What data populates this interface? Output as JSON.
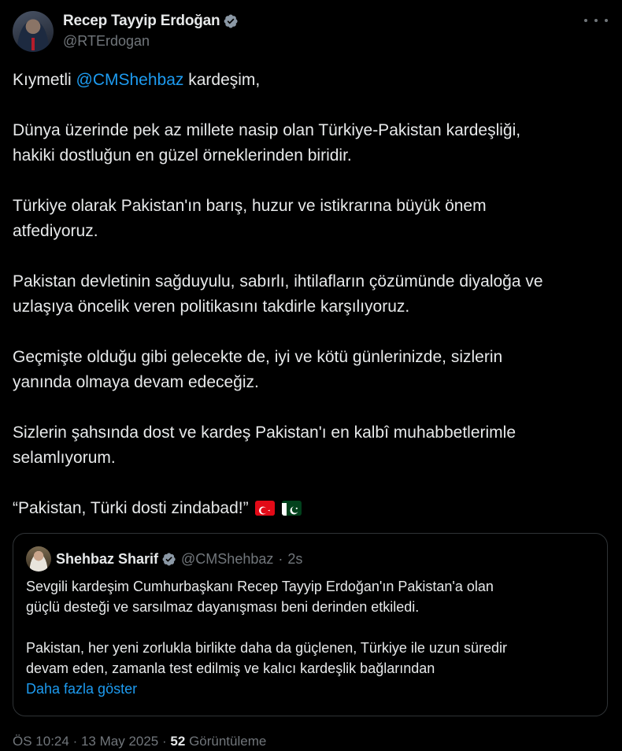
{
  "author": {
    "display_name": "Recep Tayyip Erdoğan",
    "handle": "@RTErdogan",
    "verified": true
  },
  "tweet": {
    "greeting_prefix": "Kıymetli ",
    "greeting_mention": "@CMShehbaz",
    "greeting_suffix": " kardeşim,",
    "paragraphs": [
      [
        "Dünya üzerinde pek az millete nasip olan Türkiye-Pakistan kardeşliği,",
        "hakiki dostluğun en güzel örneklerinden biridir."
      ],
      [
        "Türkiye olarak Pakistan'ın barış, huzur ve istikrarına büyük önem",
        "atfediyoruz."
      ],
      [
        "Pakistan devletinin sağduyulu, sabırlı, ihtilafların çözümünde diyaloğa ve",
        "uzlaşıya öncelik veren politikasını takdirle karşılıyoruz."
      ],
      [
        "Geçmişte olduğu gibi gelecekte de, iyi ve kötü günlerinizde, sizlerin",
        "yanında olmaya devam edeceğiz."
      ],
      [
        "Sizlerin şahsında dost ve kardeş Pakistan'ı en kalbî muhabbetlerimle",
        "selamlıyorum."
      ]
    ],
    "closing": "“Pakistan, Türki dosti zindabad!”",
    "flags": [
      "turkey-flag",
      "pakistan-flag"
    ]
  },
  "quoted": {
    "display_name": "Shehbaz Sharif",
    "handle": "@CMShehbaz",
    "separator": "·",
    "time": "2s",
    "paragraphs": [
      [
        "Sevgili kardeşim Cumhurbaşkanı Recep Tayyip Erdoğan'ın Pakistan'a olan",
        "güçlü desteği ve sarsılmaz dayanışması beni derinden etkiledi."
      ],
      [
        "Pakistan, her yeni zorlukla birlikte daha da güçlenen, Türkiye ile uzun süredir",
        "devam eden, zamanla test edilmiş ve kalıcı kardeşlik bağlarından"
      ]
    ],
    "show_more": "Daha fazla göster"
  },
  "meta": {
    "time": "ÖS 10:24",
    "separator": "·",
    "date": "13 May 2025",
    "views_count": "52",
    "views_label": "Görüntüleme"
  },
  "colors": {
    "background": "#000000",
    "text": "#e7e9ea",
    "secondary": "#71767b",
    "link": "#1d9bf0"
  }
}
